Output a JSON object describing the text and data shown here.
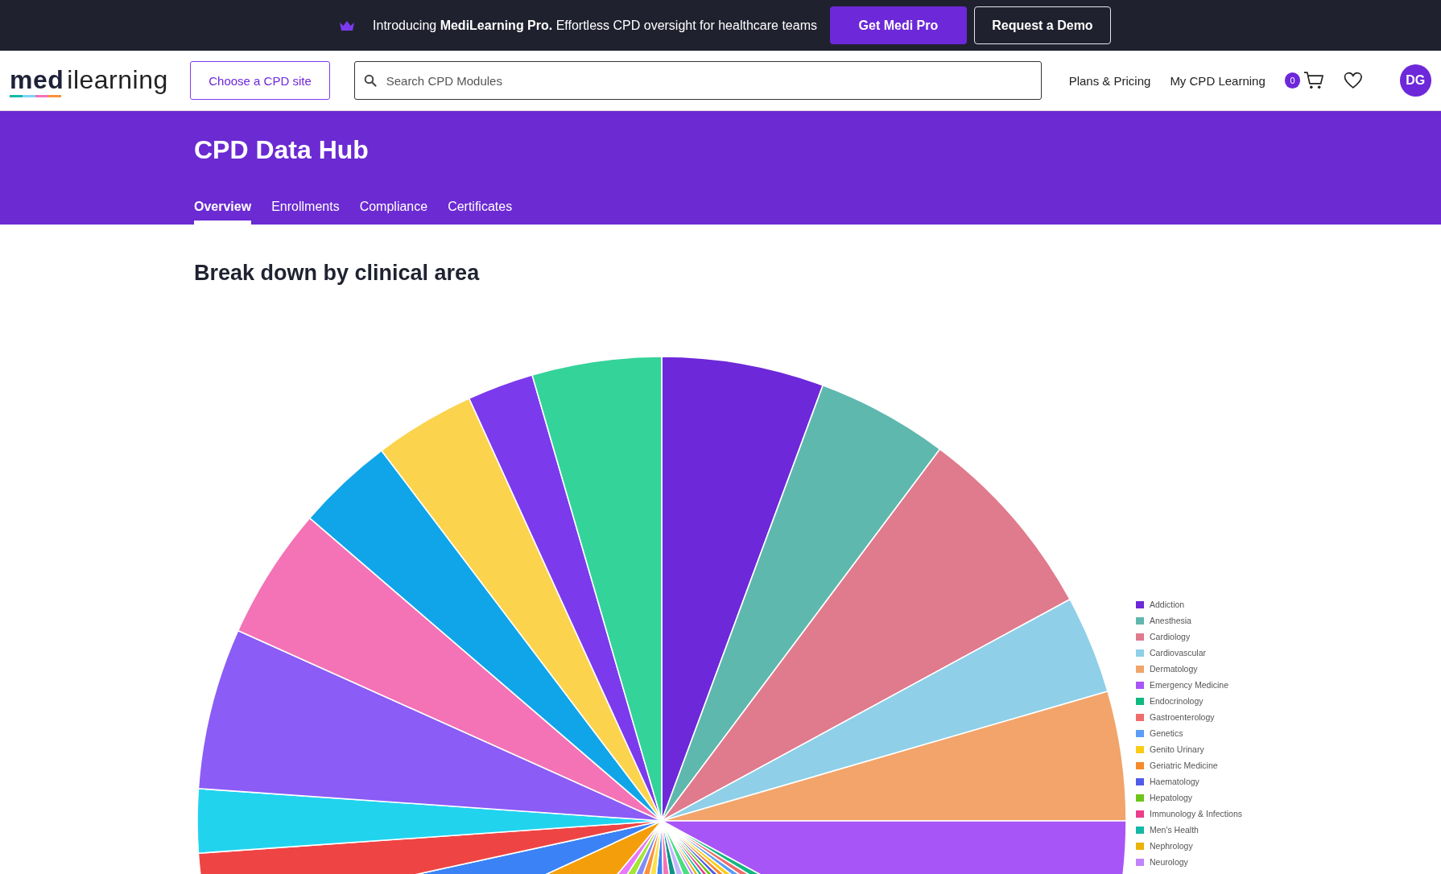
{
  "announcement": {
    "text": "Introducing **MediLearning Pro.** Effortless CPD oversight for healthcare teams",
    "buttons": [
      {
        "label": "Get Medi Pro",
        "kind": "primary"
      },
      {
        "label": "Request a Demo",
        "kind": "outline"
      }
    ]
  },
  "header": {
    "logo": "**med**ilearning",
    "site_button": "Choose a CPD site",
    "search": {
      "placeholder": "Search CPD Modules"
    },
    "nav_links": [
      "Plans & Pricing",
      "My CPD Learning"
    ],
    "cart_count": "0",
    "avatar": "DG"
  },
  "hero": {
    "title": "CPD Data Hub",
    "tabs": [
      {
        "label": "Overview",
        "selected": true
      },
      {
        "label": "Enrollments",
        "selected": false
      },
      {
        "label": "Compliance",
        "selected": false
      },
      {
        "label": "Certificates",
        "selected": false
      }
    ]
  },
  "section": {
    "title": "Break down by clinical area",
    "legend": [
      {
        "label": "Addiction",
        "color": "#6d28d9"
      },
      {
        "label": "Anesthesia",
        "color": "#5fb8ad"
      },
      {
        "label": "Cardiology",
        "color": "#e07a8d"
      },
      {
        "label": "Cardiovascular",
        "color": "#8fcfe8"
      },
      {
        "label": "Dermatology",
        "color": "#f2a46a"
      },
      {
        "label": "Emergency Medicine",
        "color": "#a855f7"
      },
      {
        "label": "Endocrinology",
        "color": "#10b981"
      },
      {
        "label": "Gastroenterology",
        "color": "#f06b6b"
      },
      {
        "label": "Genetics",
        "color": "#5b9cf5"
      },
      {
        "label": "Genito Urinary",
        "color": "#facc15"
      },
      {
        "label": "Geriatric Medicine",
        "color": "#f58a2a"
      },
      {
        "label": "Haematology",
        "color": "#4f5bea"
      },
      {
        "label": "Hepatology",
        "color": "#6cc417"
      },
      {
        "label": "Immunology & Infections",
        "color": "#ec3c8a"
      },
      {
        "label": "Men's Health",
        "color": "#14b8a6"
      },
      {
        "label": "Nephrology",
        "color": "#eab308"
      },
      {
        "label": "Neurology",
        "color": "#c084fc"
      }
    ]
  }
}
